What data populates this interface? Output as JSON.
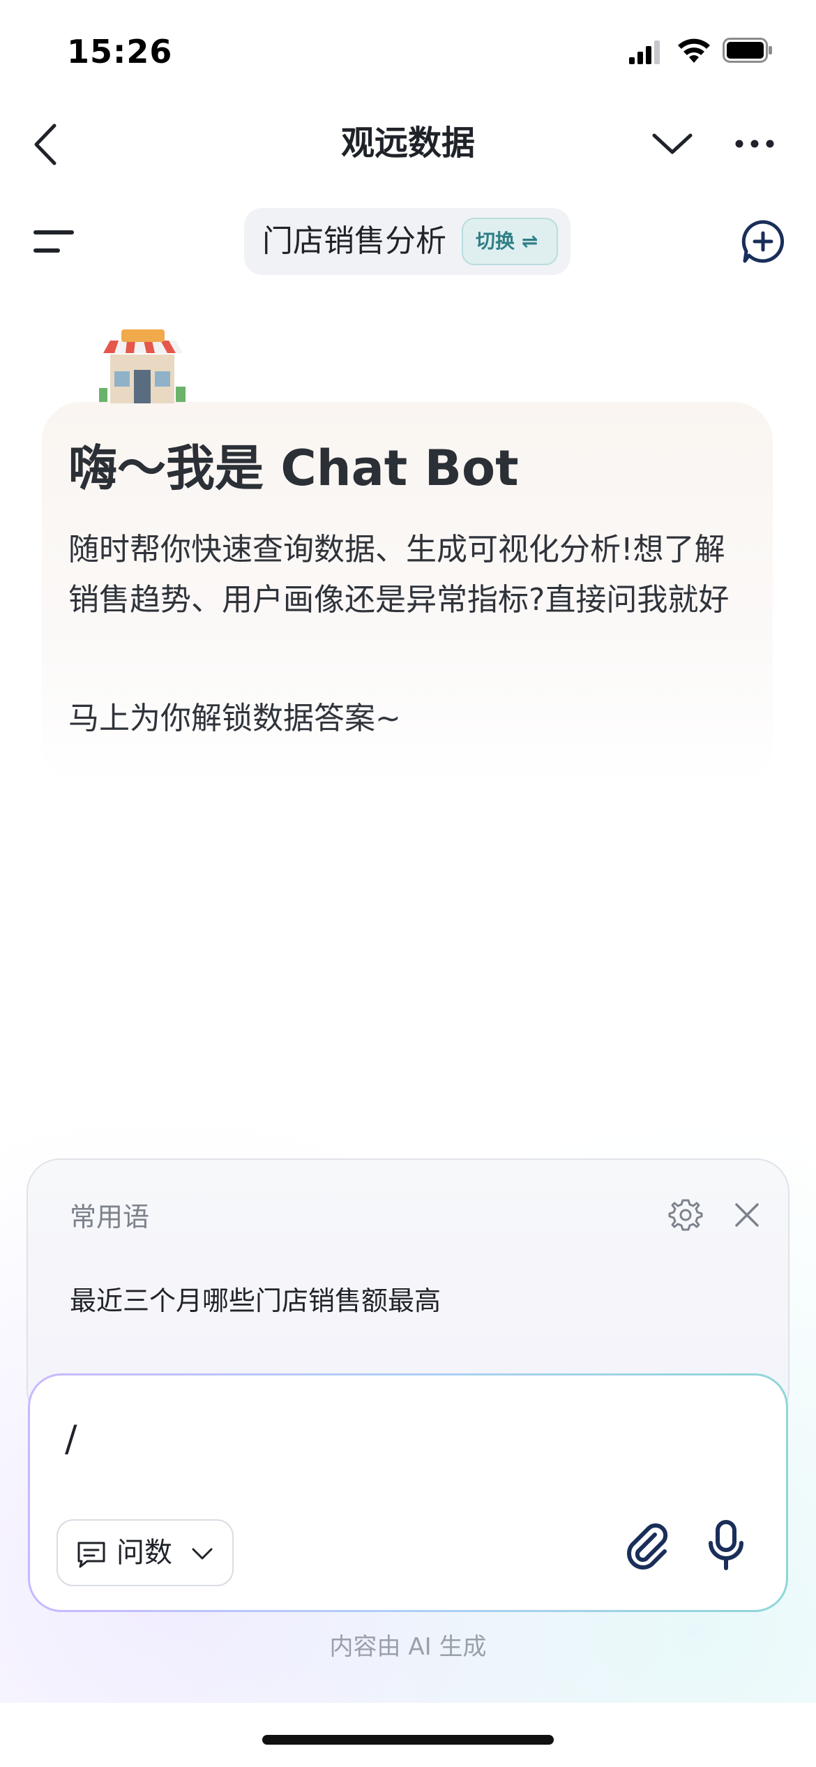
{
  "status_bar": {
    "time": "15:26"
  },
  "nav": {
    "title": "观远数据"
  },
  "assistant_switch": {
    "name": "门店销售分析",
    "badge": "切换 ⇌"
  },
  "welcome": {
    "title": "嗨～我是 Chat Bot",
    "description": "随时帮你快速查询数据、生成可视化分析!想了解销售趋势、用户画像还是异常指标?直接问我就好",
    "cta": "马上为你解锁数据答案~"
  },
  "phrases": {
    "title": "常用语",
    "items": [
      "最近三个月哪些门店销售额最高"
    ]
  },
  "input": {
    "value": "/",
    "mode_label": "问数"
  },
  "footer": {
    "note": "内容由 AI 生成"
  },
  "icons": {
    "back": "chevron-left-icon",
    "dropdown": "chevron-down-icon",
    "more": "more-horizontal-icon",
    "menu": "menu-icon",
    "new_chat": "new-chat-icon",
    "settings": "gear-icon",
    "close": "close-icon",
    "attach": "paperclip-icon",
    "mic": "microphone-icon",
    "mode": "chat-bubble-icon"
  },
  "colors": {
    "accent_teal": "#2f7f86",
    "badge_bg": "#dfeff0",
    "text_primary": "#1f2329",
    "text_secondary": "#7c828c"
  }
}
